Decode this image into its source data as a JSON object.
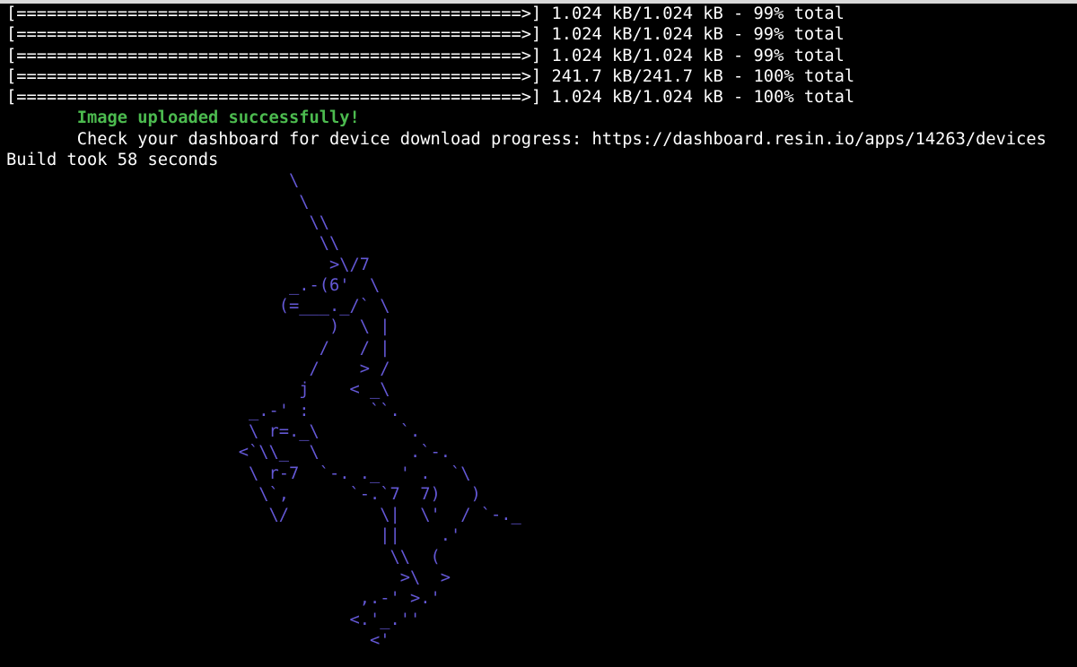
{
  "colors": {
    "background": "#000000",
    "text": "#ffffff",
    "success": "#4cbb4f",
    "ascii_art": "#6458d6",
    "window_edge": "#d9d9d9"
  },
  "progress_lines": [
    "[==================================================>] 1.024 kB/1.024 kB - 99% total",
    "[==================================================>] 1.024 kB/1.024 kB - 99% total",
    "[==================================================>] 1.024 kB/1.024 kB - 99% total",
    "[==================================================>] 241.7 kB/241.7 kB - 100% total",
    "[==================================================>] 1.024 kB/1.024 kB - 100% total"
  ],
  "messages": {
    "success": "       Image uploaded successfully!",
    "dashboard": "       Check your dashboard for device download progress: https://dashboard.resin.io/apps/14263/devices",
    "build_time": "Build took 58 seconds"
  },
  "ascii_art": "                            \\\n                             \\\n                              \\\\\n                               \\\\\n                                >\\/7\n                            _.-(6'  \\\n                           (=___._/` \\\n                                )  \\ |\n                               /   / |\n                              /    > /\n                             j    < _\\\n                        _.-' :      ``.\n                        \\ r=._\\        `.\n                       <`\\\\_  \\         .`-.\n                        \\ r-7  `-. ._  ' .  `\\\n                         \\`,      `-.`7  7)   )\n                          \\/         \\|  \\'  / `-._\n                                     ||    .'\n                                      \\\\  (\n                                       >\\  >\n                                   ,.-' >.'\n                                  <.'_.''\n                                    <'"
}
